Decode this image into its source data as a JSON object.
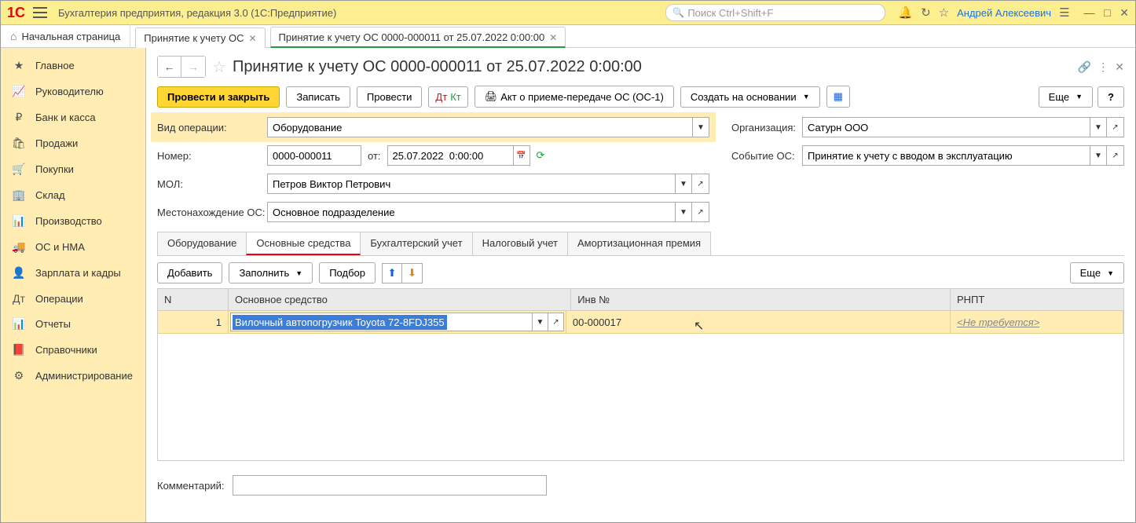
{
  "app": {
    "title": "Бухгалтерия предприятия, редакция 3.0  (1С:Предприятие)",
    "search_placeholder": "Поиск Ctrl+Shift+F",
    "user": "Андрей Алексеевич"
  },
  "tabs": {
    "home": "Начальная страница",
    "t1": "Принятие к учету ОС",
    "t2": "Принятие к учету ОС 0000-000011 от 25.07.2022 0:00:00"
  },
  "sidebar": [
    {
      "icon": "★",
      "label": "Главное"
    },
    {
      "icon": "📈",
      "label": "Руководителю"
    },
    {
      "icon": "₽",
      "label": "Банк и касса"
    },
    {
      "icon": "🛍",
      "label": "Продажи"
    },
    {
      "icon": "🛒",
      "label": "Покупки"
    },
    {
      "icon": "🏢",
      "label": "Склад"
    },
    {
      "icon": "📊",
      "label": "Производство"
    },
    {
      "icon": "🚚",
      "label": "ОС и НМА"
    },
    {
      "icon": "👤",
      "label": "Зарплата и кадры"
    },
    {
      "icon": "Дт",
      "label": "Операции"
    },
    {
      "icon": "📊",
      "label": "Отчеты"
    },
    {
      "icon": "📕",
      "label": "Справочники"
    },
    {
      "icon": "⚙",
      "label": "Администрирование"
    }
  ],
  "doc": {
    "title": "Принятие к учету ОС 0000-000011 от 25.07.2022 0:00:00",
    "actions": {
      "post_close": "Провести и закрыть",
      "save": "Записать",
      "post": "Провести",
      "act": "Акт о приеме-передаче ОС (ОС-1)",
      "create_based": "Создать на основании",
      "more": "Еще"
    },
    "form": {
      "op_type_lbl": "Вид операции:",
      "op_type": "Оборудование",
      "num_lbl": "Номер:",
      "num": "0000-000011",
      "from_lbl": "от:",
      "date": "25.07.2022  0:00:00",
      "mol_lbl": "МОЛ:",
      "mol": "Петров Виктор Петрович",
      "loc_lbl": "Местонахождение ОС:",
      "loc": "Основное подразделение",
      "org_lbl": "Организация:",
      "org": "Сатурн ООО",
      "event_lbl": "Событие ОС:",
      "event": "Принятие к учету с вводом в эксплуатацию"
    },
    "form_tabs": [
      "Оборудование",
      "Основные средства",
      "Бухгалтерский учет",
      "Налоговый учет",
      "Амортизационная премия"
    ],
    "table_actions": {
      "add": "Добавить",
      "fill": "Заполнить",
      "pick": "Подбор",
      "more": "Еще"
    },
    "table": {
      "head": {
        "n": "N",
        "os": "Основное средство",
        "inv": "Инв №",
        "rnpt": "РНПТ"
      },
      "row": {
        "n": "1",
        "os": "Вилочный автопогрузчик Toyota 72-8FDJ355",
        "inv": "00-000017",
        "rnpt": "<Не требуется>"
      }
    },
    "comment_lbl": "Комментарий:"
  }
}
